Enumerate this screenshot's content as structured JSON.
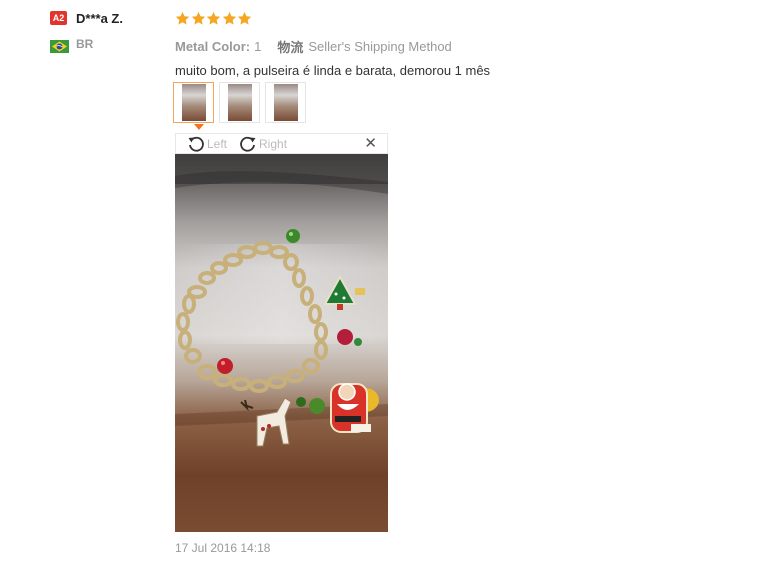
{
  "reviewer": {
    "level_badge": "A2",
    "name": "D***a Z.",
    "country_code": "BR",
    "flag_icon": "brazil-flag-icon"
  },
  "review": {
    "rating": 5,
    "rating_max": 5,
    "star_color": "#f5a623",
    "attributes": {
      "metal_color_key": "Metal Color:",
      "metal_color_value": "1",
      "shipping_key": "物流",
      "shipping_value": "Seller's Shipping Method"
    },
    "text": "muito bom, a pulseira é linda e barata, demorou 1 mês",
    "date": "17 Jul 2016 14:18"
  },
  "thumbnails": {
    "count": 3,
    "selected_index": 0,
    "selected_border_color": "#f7a35c"
  },
  "viewer": {
    "rotate_left_label": "Left",
    "rotate_right_label": "Right",
    "close_icon": "close-icon"
  },
  "colors": {
    "badge": "#e0342c",
    "accent_arrow": "#f57224"
  }
}
